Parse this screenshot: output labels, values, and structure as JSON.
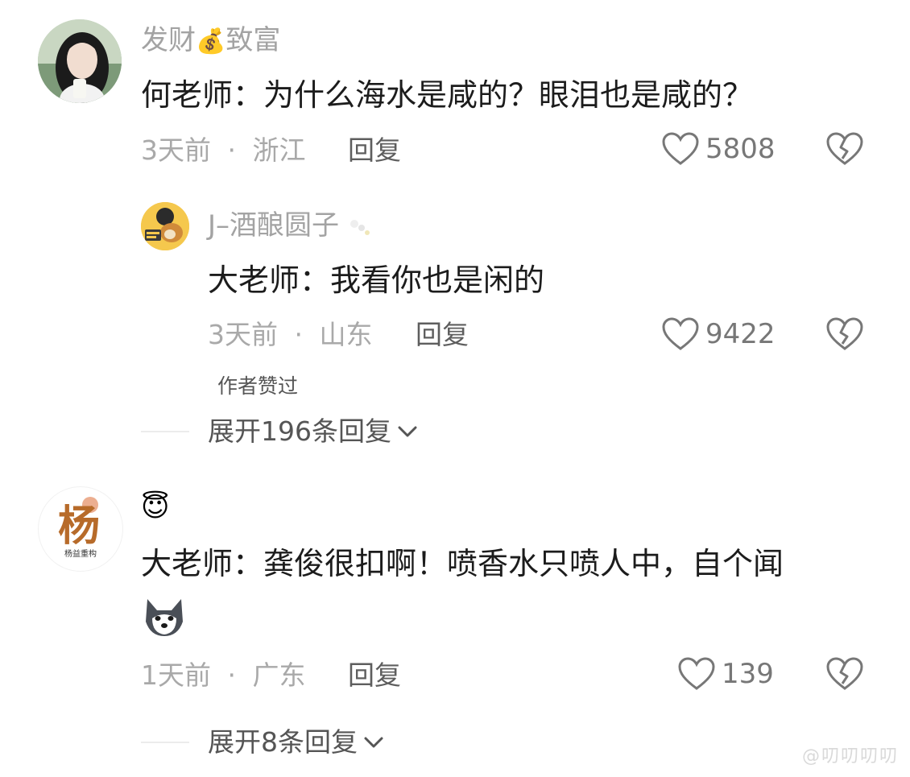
{
  "comments": [
    {
      "username": "发财",
      "username_emoji": "💰",
      "username_suffix": "致富",
      "text": "何老师：为什么海水是咸的？眼泪也是咸的？",
      "time": "3天前",
      "sep": "·",
      "location": "浙江",
      "reply_label": "回复",
      "likes": "5808",
      "replies": [
        {
          "username": "J–酒酿圆子",
          "text": "大老师：我看你也是闲的",
          "time": "3天前",
          "sep": "·",
          "location": "山东",
          "reply_label": "回复",
          "likes": "9422",
          "author_liked": "作者赞过"
        }
      ],
      "expand_label": "展开196条回复"
    },
    {
      "username_emoji": "😇",
      "text": "大老师：龚俊很扣啊！喷香水只喷人中，自个闻",
      "time": "1天前",
      "sep": "·",
      "location": "广东",
      "reply_label": "回复",
      "likes": "139",
      "expand_label": "展开8条回复"
    }
  ],
  "avatar2_text": "杨益重构",
  "avatar2_mark": "杨",
  "watermark": "@叨叨叨叨"
}
